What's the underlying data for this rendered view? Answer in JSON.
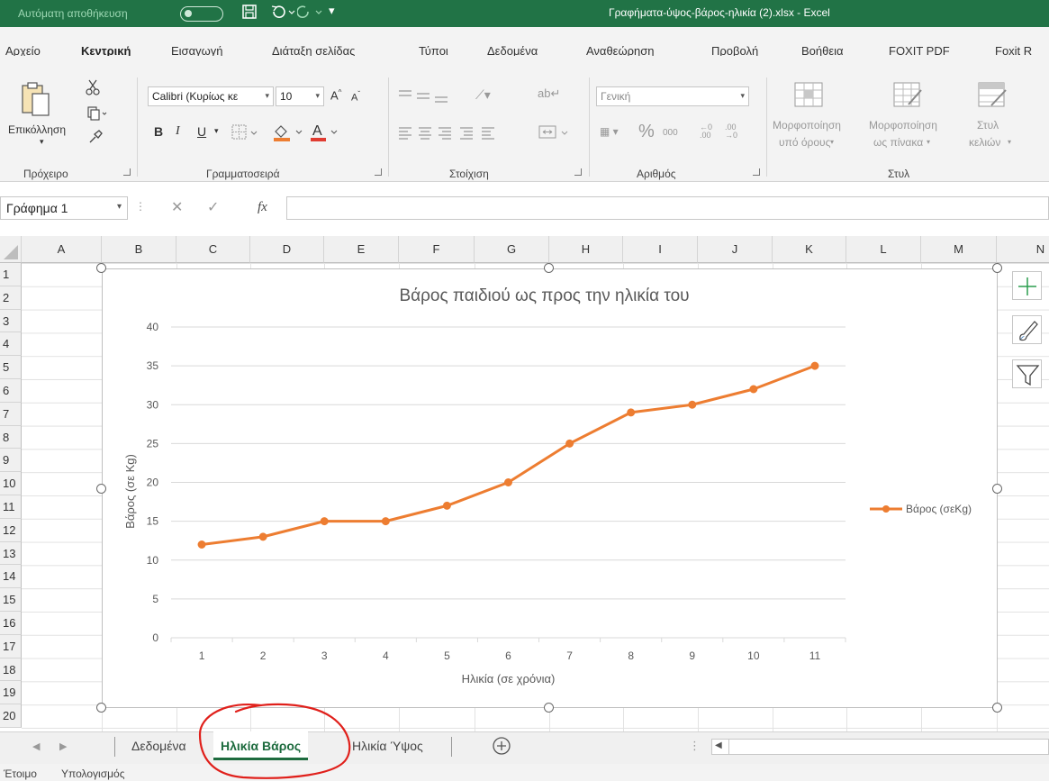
{
  "titlebar": {
    "autosave_label": "Αυτόματη αποθήκευση",
    "document_title": "Γραφήματα-ύψος-βάρος-ηλικία (2).xlsx  -  Excel"
  },
  "ribbon_tabs": [
    "Αρχείο",
    "Κεντρική",
    "Εισαγωγή",
    "Διάταξη σελίδας",
    "Τύποι",
    "Δεδομένα",
    "Αναθεώρηση",
    "Προβολή",
    "Βοήθεια",
    "FOXIT PDF",
    "Foxit R"
  ],
  "active_ribbon_tab": "Κεντρική",
  "ribbon": {
    "paste_label": "Επικόλληση",
    "clipboard_group": "Πρόχειρο",
    "font_name": "Calibri (Κυρίως κε",
    "font_size": "10",
    "bold": "B",
    "italic": "I",
    "underline": "U",
    "font_group": "Γραμματοσειρά",
    "alignment_group": "Στοίχιση",
    "number_format": "Γενική",
    "number_group": "Αριθμός",
    "percent": "%",
    "thousands": "000",
    "cond_format_line1": "Μορφοποίηση",
    "cond_format_line2": "υπό όρους",
    "format_table_line1": "Μορφοποίηση",
    "format_table_line2": "ως πίνακα",
    "cell_styles_line1": "Στυλ",
    "cell_styles_line2": "κελιών",
    "styles_group": "Στυλ",
    "font_color_accent": "#e03c31",
    "fill_color_accent": "#ed7d31"
  },
  "formula_bar": {
    "name_box": "Γράφημα 1",
    "fx": "fx",
    "formula": ""
  },
  "columns": [
    "A",
    "B",
    "C",
    "D",
    "E",
    "F",
    "G",
    "H",
    "I",
    "J",
    "K",
    "L",
    "M",
    "N"
  ],
  "rows": [
    "1",
    "2",
    "3",
    "4",
    "5",
    "6",
    "7",
    "8",
    "9",
    "10",
    "11",
    "12",
    "13",
    "14",
    "15",
    "16",
    "17",
    "18",
    "19",
    "20"
  ],
  "chart_data": {
    "type": "line",
    "title": "Βάρος παιδιού ως προς την ηλικία του",
    "xlabel": "Ηλικία (σε χρόνια)",
    "ylabel": "Βάρος (σε Kg)",
    "categories": [
      "1",
      "2",
      "3",
      "4",
      "5",
      "6",
      "7",
      "8",
      "9",
      "10",
      "11"
    ],
    "series": [
      {
        "name": "Βάρος (σεKg)",
        "values": [
          12,
          13,
          15,
          15,
          17,
          20,
          25,
          29,
          30,
          32,
          35
        ],
        "color": "#ed7d31"
      }
    ],
    "ylim": [
      0,
      40
    ],
    "yticks": [
      "0",
      "5",
      "10",
      "15",
      "20",
      "25",
      "30",
      "35",
      "40"
    ],
    "grid": true,
    "legend_position": "right",
    "markers": true
  },
  "sheet_tabs": [
    "Δεδομένα",
    "Ηλικία Βάρος",
    "Ηλικία Ύψος"
  ],
  "active_sheet": "Ηλικία Βάρος",
  "status": {
    "ready": "Έτοιμο",
    "calculate": "Υπολογισμός"
  },
  "colors": {
    "excel_green": "#217346",
    "active_sheet_green": "#1d6b3e",
    "annotation_red": "#e0201b"
  }
}
